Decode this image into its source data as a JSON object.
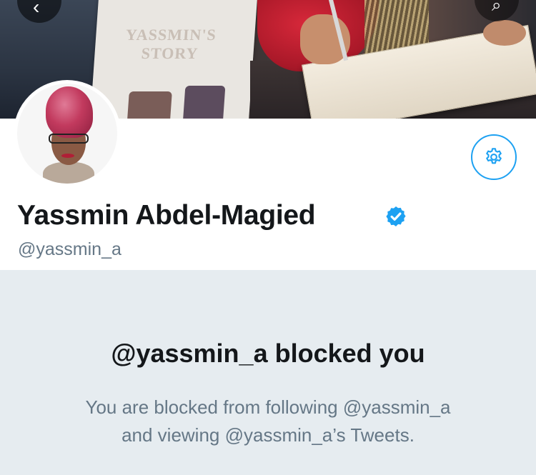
{
  "profile": {
    "display_name": "Yassmin Abdel-Magied",
    "handle": "@yassmin_a",
    "verified": true
  },
  "banner": {
    "poster_text": "YASSMIN'S STORY"
  },
  "blocked": {
    "title": "@yassmin_a blocked you",
    "description_line1": "You are blocked from following @yassmin_a",
    "description_line2": "and viewing @yassmin_a’s Tweets."
  },
  "icons": {
    "back": "chevron-left-icon",
    "search": "search-icon",
    "settings": "gear-icon",
    "verified": "verified-badge-icon"
  },
  "colors": {
    "accent": "#1da1f2",
    "text_primary": "#14171a",
    "text_secondary": "#657786",
    "panel_bg": "#e6ecf0"
  }
}
